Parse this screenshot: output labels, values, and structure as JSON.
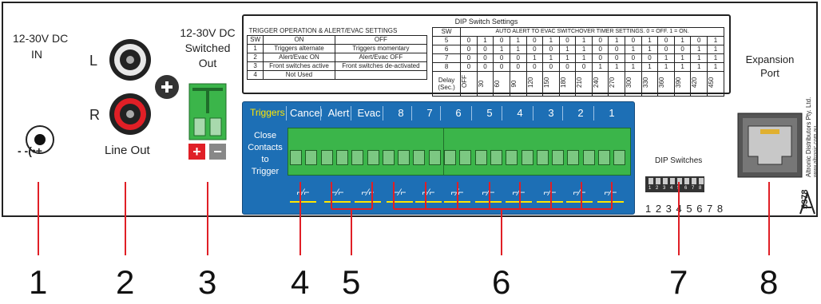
{
  "labels": {
    "dc_in": [
      "12-30V DC",
      "IN"
    ],
    "polarity": "- -(•+",
    "line_out_L": "L",
    "line_out_R": "R",
    "line_out": "Line Out",
    "switched_out": [
      "12-30V DC",
      "Switched",
      "Out"
    ],
    "plus": "+",
    "minus": "−",
    "dip_title": "DIP Switch Settings",
    "dip_switches": "DIP Switches",
    "dip_numbers": "1 2 3 4 5 6 7 8",
    "dip_key_numbers": [
      "1",
      "2",
      "3",
      "4",
      "5",
      "6",
      "7",
      "8"
    ],
    "expansion": [
      "Expansion",
      "Port"
    ],
    "brand": "Altronic Distributors Pty. Ltd.",
    "web": "www.altronic.com.au",
    "model": "5378"
  },
  "trigger_table": {
    "title": "TRIGGER OPERATION & ALERT/EVAC SETTINGS",
    "headers": [
      "SW",
      "ON",
      "OFF"
    ],
    "rows": [
      [
        "1",
        "Triggers alternate",
        "Triggers momentary"
      ],
      [
        "2",
        "Alert/Evac ON",
        "Alert/Evac OFF"
      ],
      [
        "3",
        "Front switches active",
        "Front switches de-activated"
      ],
      [
        "4",
        "Not Used",
        ""
      ]
    ]
  },
  "timer_table": {
    "sw_header": "SW",
    "title": "AUTO ALERT TO EVAC SWITCHOVER TIMER SETTINGS. 0 = OFF. 1 = ON.",
    "rows": [
      {
        "sw": "5",
        "bits": [
          "0",
          "1",
          "0",
          "1",
          "0",
          "1",
          "0",
          "1",
          "0",
          "1",
          "0",
          "1",
          "0",
          "1",
          "0",
          "1"
        ]
      },
      {
        "sw": "6",
        "bits": [
          "0",
          "0",
          "1",
          "1",
          "0",
          "0",
          "1",
          "1",
          "0",
          "0",
          "1",
          "1",
          "0",
          "0",
          "1",
          "1"
        ]
      },
      {
        "sw": "7",
        "bits": [
          "0",
          "0",
          "0",
          "0",
          "1",
          "1",
          "1",
          "1",
          "0",
          "0",
          "0",
          "0",
          "1",
          "1",
          "1",
          "1"
        ]
      },
      {
        "sw": "8",
        "bits": [
          "0",
          "0",
          "0",
          "0",
          "0",
          "0",
          "0",
          "0",
          "1",
          "1",
          "1",
          "1",
          "1",
          "1",
          "1",
          "1"
        ]
      }
    ],
    "delay_label": [
      "Delay",
      "(Sec.)"
    ],
    "delays": [
      "OFF",
      "30",
      "60",
      "90",
      "120",
      "150",
      "180",
      "210",
      "240",
      "270",
      "300",
      "330",
      "360",
      "390",
      "420",
      "450"
    ]
  },
  "triggers": {
    "title": "Triggers",
    "close_contacts": [
      "Close",
      "Contacts",
      "to",
      "Trigger"
    ],
    "inputs": [
      "Cancel",
      "Alert",
      "Evac",
      "8",
      "7",
      "6",
      "5",
      "4",
      "3",
      "2",
      "1"
    ],
    "switch_symbol": "⌐⁄⌐"
  },
  "callouts": [
    "1",
    "2",
    "3",
    "4",
    "5",
    "6",
    "7",
    "8"
  ],
  "colors": {
    "trigger_panel": "#1d6fb5",
    "terminal_green": "#3bb54a",
    "rca_white": "#e8e8e8",
    "rca_red": "#e01f26",
    "callout_line": "#e01f26",
    "plus_red": "#e01f26",
    "minus_grey": "#888888",
    "yellow": "#ffe600"
  }
}
